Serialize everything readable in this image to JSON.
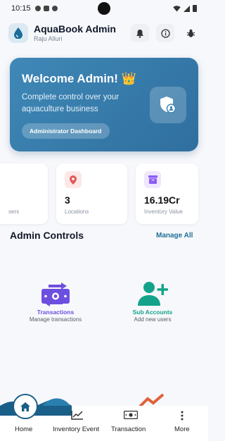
{
  "status_bar": {
    "time": "10:15"
  },
  "header": {
    "title": "AquaBook Admin",
    "subtitle": "Raju Alluri",
    "icons": [
      "droplet-icon",
      "bell-icon",
      "info-icon",
      "bug-icon"
    ]
  },
  "welcome": {
    "title": "Welcome Admin! 👑",
    "description": "Complete control over your aquaculture business",
    "button_label": "Administrator Dashboard",
    "icon": "shield-user-icon"
  },
  "stats": [
    {
      "value": "",
      "label": "sers",
      "icon": "users-icon"
    },
    {
      "value": "3",
      "label": "Locations",
      "icon": "location-pin-icon",
      "color": "#e25b5b"
    },
    {
      "value": "16.19Cr",
      "label": "Inventory Value",
      "icon": "archive-box-icon",
      "color": "#8b5cf6"
    }
  ],
  "admin_controls": {
    "title": "Admin Controls",
    "manage_all": "Manage All",
    "items": [
      {
        "title": "Transactions",
        "subtitle": "Manage transactions",
        "icon": "money-transfer-icon",
        "color": "#6d4fe0"
      },
      {
        "title": "Sub Accounts",
        "subtitle": "Add new users",
        "icon": "add-user-icon",
        "color": "#14a38a"
      }
    ]
  },
  "bottom_nav": {
    "items": [
      {
        "label": "Home",
        "icon": "home-icon"
      },
      {
        "label": "Inventory Event",
        "icon": "chart-line-icon"
      },
      {
        "label": "Transaction",
        "icon": "cash-icon"
      },
      {
        "label": "More",
        "icon": "more-vertical-icon"
      }
    ]
  },
  "colors": {
    "accent": "#2f6f9f",
    "brand": "#1e6f96"
  }
}
